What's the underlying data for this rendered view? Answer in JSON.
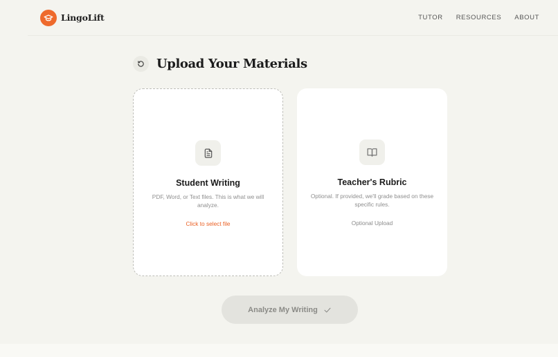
{
  "header": {
    "brand": "LingoLift",
    "nav": [
      "TUTOR",
      "RESOURCES",
      "ABOUT"
    ]
  },
  "main": {
    "title": "Upload Your Materials",
    "cards": [
      {
        "title": "Student Writing",
        "description": "PDF, Word, or Text files. This is what we will analyze.",
        "action": "Click to select file",
        "icon": "document-icon"
      },
      {
        "title": "Teacher's Rubric",
        "description": "Optional. If provided, we'll grade based on these specific rules.",
        "action": "Optional Upload",
        "icon": "book-icon"
      }
    ],
    "analyze_button": "Analyze My Writing",
    "analyze_icon": "check-icon"
  },
  "colors": {
    "accent": "#ee6a2c",
    "background": "#f4f4ef",
    "card": "#ffffff"
  }
}
